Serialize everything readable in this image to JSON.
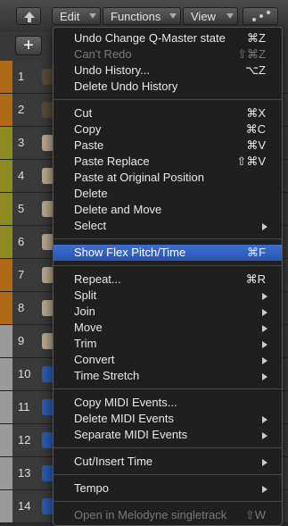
{
  "toolbar": {
    "up_icon": "up-arrow-icon",
    "edit_label": "Edit",
    "functions_label": "Functions",
    "view_label": "View",
    "tool_icon": "pointer-tool-icon"
  },
  "tracks": [
    {
      "n": "1",
      "color": "#b06a16"
    },
    {
      "n": "2",
      "color": "#b06a16"
    },
    {
      "n": "3",
      "color": "#8c8c20"
    },
    {
      "n": "4",
      "color": "#8c8c20"
    },
    {
      "n": "5",
      "color": "#8c8c20"
    },
    {
      "n": "6",
      "color": "#8c8c20"
    },
    {
      "n": "7",
      "color": "#b06a16"
    },
    {
      "n": "8",
      "color": "#b06a16"
    },
    {
      "n": "9",
      "color": "#9a9a9a"
    },
    {
      "n": "10",
      "color": "#9a9a9a"
    },
    {
      "n": "11",
      "color": "#9a9a9a"
    },
    {
      "n": "12",
      "color": "#9a9a9a"
    },
    {
      "n": "13",
      "color": "#9a9a9a"
    },
    {
      "n": "14",
      "color": "#9a9a9a"
    }
  ],
  "menu": {
    "items": [
      {
        "label": "Undo Change Q-Master state",
        "shortcut": "⌘Z"
      },
      {
        "label": "Can't Redo",
        "shortcut": "⇧⌘Z",
        "disabled": true
      },
      {
        "label": "Undo History...",
        "shortcut": "⌥Z"
      },
      {
        "label": "Delete Undo History",
        "shortcut": ""
      },
      {
        "label": "Cut",
        "shortcut": "⌘X"
      },
      {
        "label": "Copy",
        "shortcut": "⌘C"
      },
      {
        "label": "Paste",
        "shortcut": "⌘V"
      },
      {
        "label": "Paste Replace",
        "shortcut": "⇧⌘V"
      },
      {
        "label": "Paste at Original Position",
        "shortcut": ""
      },
      {
        "label": "Delete",
        "shortcut": ""
      },
      {
        "label": "Delete and Move",
        "shortcut": ""
      },
      {
        "label": "Select",
        "submenu": true
      },
      {
        "label": "Show Flex Pitch/Time",
        "shortcut": "⌘F",
        "selected": true
      },
      {
        "label": "Repeat...",
        "shortcut": "⌘R"
      },
      {
        "label": "Split",
        "submenu": true
      },
      {
        "label": "Join",
        "submenu": true
      },
      {
        "label": "Move",
        "submenu": true
      },
      {
        "label": "Trim",
        "submenu": true
      },
      {
        "label": "Convert",
        "submenu": true
      },
      {
        "label": "Time Stretch",
        "submenu": true
      },
      {
        "label": "Copy MIDI Events...",
        "shortcut": ""
      },
      {
        "label": "Delete MIDI Events",
        "submenu": true
      },
      {
        "label": "Separate MIDI Events",
        "submenu": true
      },
      {
        "label": "Cut/Insert Time",
        "submenu": true
      },
      {
        "label": "Tempo",
        "submenu": true
      },
      {
        "label": "Open in Melodyne singletrack",
        "shortcut": "⇧W",
        "disabled": true
      }
    ]
  },
  "colors": {
    "accent": "#2f5fc4"
  }
}
